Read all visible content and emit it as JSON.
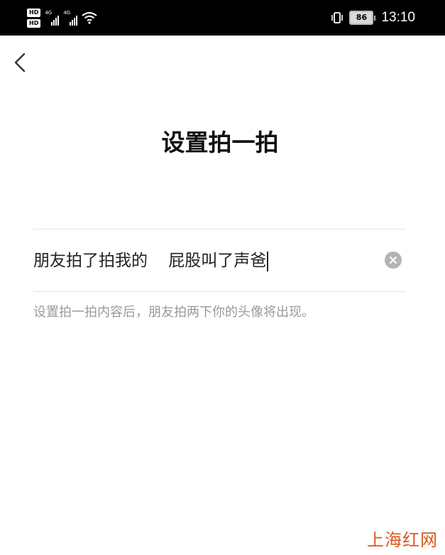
{
  "status_bar": {
    "hd_badges": [
      "HD",
      "HD"
    ],
    "network_labels": [
      "4G",
      "4G"
    ],
    "battery_level": "86",
    "time": "13:10",
    "icons": [
      "signal-icon",
      "signal-icon",
      "wifi-icon",
      "vibrate-icon",
      "battery-icon"
    ]
  },
  "nav": {
    "back_icon": "chevron-left-icon"
  },
  "page": {
    "title": "设置拍一拍"
  },
  "input": {
    "value": "朋友拍了拍我的    屁股叫了声爸",
    "clear_icon": "clear-icon"
  },
  "hint": {
    "text": "设置拍一拍内容后，朋友拍两下你的头像将出现。"
  },
  "watermark": {
    "text": "上海红网"
  },
  "colors": {
    "status_bar_bg": "#000000",
    "background": "#ffffff",
    "title": "#111111",
    "hint": "#9a9a9a",
    "watermark": "#d85a1e"
  }
}
